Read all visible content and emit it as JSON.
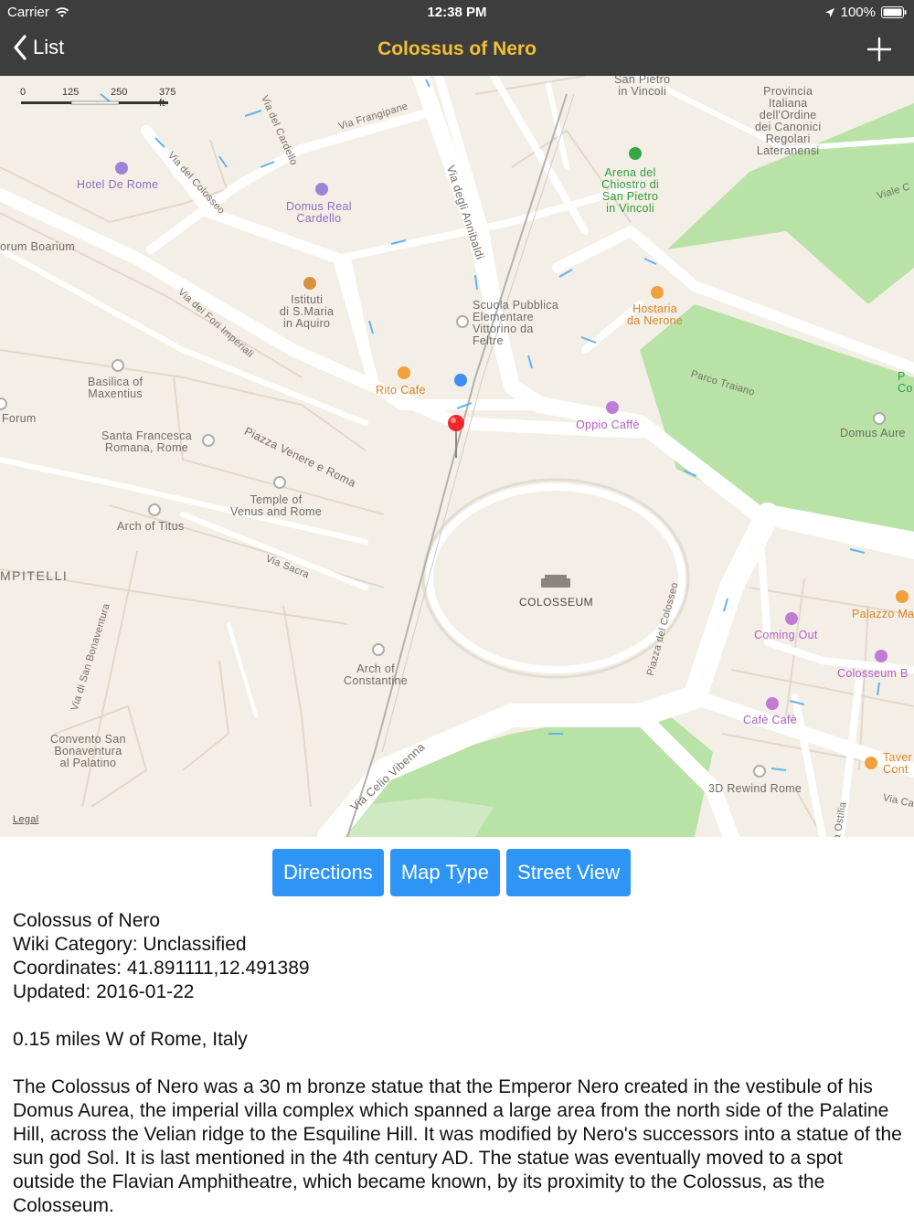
{
  "status_bar": {
    "carrier": "Carrier",
    "time": "12:38 PM",
    "battery": "100%"
  },
  "nav": {
    "back_label": "List",
    "title": "Colossus of Nero",
    "accent_color": "#f3c033",
    "bar_color": "#3d3d3e"
  },
  "map": {
    "scale_labels": [
      "0",
      "125",
      "250",
      "375 ft"
    ],
    "legal": "Legal",
    "landmark": "COLOSSEUM",
    "places": {
      "hotel_de_rome": "Hotel De Rome",
      "domus_real": "Domus Real\nCardello",
      "forum_boarium": "orum Boarium",
      "istituti": "Istituti\ndi S.Maria\nin Aquiro",
      "basilica": "Basilica of\nMaxentius",
      "forum": "Forum",
      "santa_francesca": "Santa Francesca\nRomana, Rome",
      "temple": "Temple of\nVenus and Rome",
      "arch_titus": "Arch of Titus",
      "campitelli": "MPITELLI",
      "arch_constantine": "Arch of\nConstantine",
      "convento": "Convento San\nBonaventura\nal Palatino",
      "rito_cafe": "Rito Cafe",
      "scuola": "Scuola Pubblica\nElementare\nVittorino da\nFeltre",
      "hostaria": "Hostaria\nda Nerone",
      "oppio": "Oppio Caffè",
      "arena": "Arena del\nChiostro di\nSan Pietro\nin Vincoli",
      "san_pietro": "San Pietro\nin Vincoli",
      "provincia": "Provincia\nItaliana\ndell'Ordine\ndei Canonici\nRegolari\nLateranensi",
      "domus_aurea": "Domus Aure",
      "coming_out": "Coming Out",
      "palazzo": "Palazzo Ma",
      "colosseum_bar": "Colosseum B",
      "cafe_cafe": "Cafè Cafè",
      "taverna": "Taver\nCont",
      "rewind": "3D Rewind Rome",
      "park_p": "P\nCo"
    },
    "roads": {
      "via_frangipane": "Via Frangipane",
      "via_cardello": "Via del Cardello",
      "via_colosseo": "Via del Colosseo",
      "via_annibaldi": "Via degli Annibaldi",
      "via_fori": "Via dei Fori Imperiali",
      "piazza_venere": "Piazza Venere e Roma",
      "via_sacra": "Via Sacra",
      "via_bonaventura": "Via di San Bonaventura",
      "piazza_colosseo": "Piazza del Colosseo",
      "via_celio": "Via Celio Vibenna",
      "parco_traiano": "Parco Traiano",
      "viale": "Viale C",
      "via_ostilia": "a Ostilia",
      "via_ca": "Via Ca"
    }
  },
  "buttons": {
    "directions": "Directions",
    "map_type": "Map Type",
    "street_view": "Street View",
    "color": "#2e95f7"
  },
  "info": {
    "name": "Colossus of Nero",
    "category": "Wiki Category: Unclassified",
    "coordinates": "Coordinates: 41.891111,12.491389",
    "updated": "Updated: 2016-01-22",
    "distance": "0.15 miles W of Rome, Italy",
    "description": "The Colossus of Nero was a 30 m bronze statue that the Emperor Nero created in the vestibule of his Domus Aurea, the imperial villa complex which spanned a large area from the north side of the Palatine Hill, across the Velian ridge to the Esquiline Hill. It was modified by Nero's successors into a statue of the sun god Sol. It is last mentioned in the 4th century AD. The statue was eventually moved to a spot outside the Flavian Amphitheatre, which became known, by its proximity to the Colossus, as the Colosseum."
  }
}
